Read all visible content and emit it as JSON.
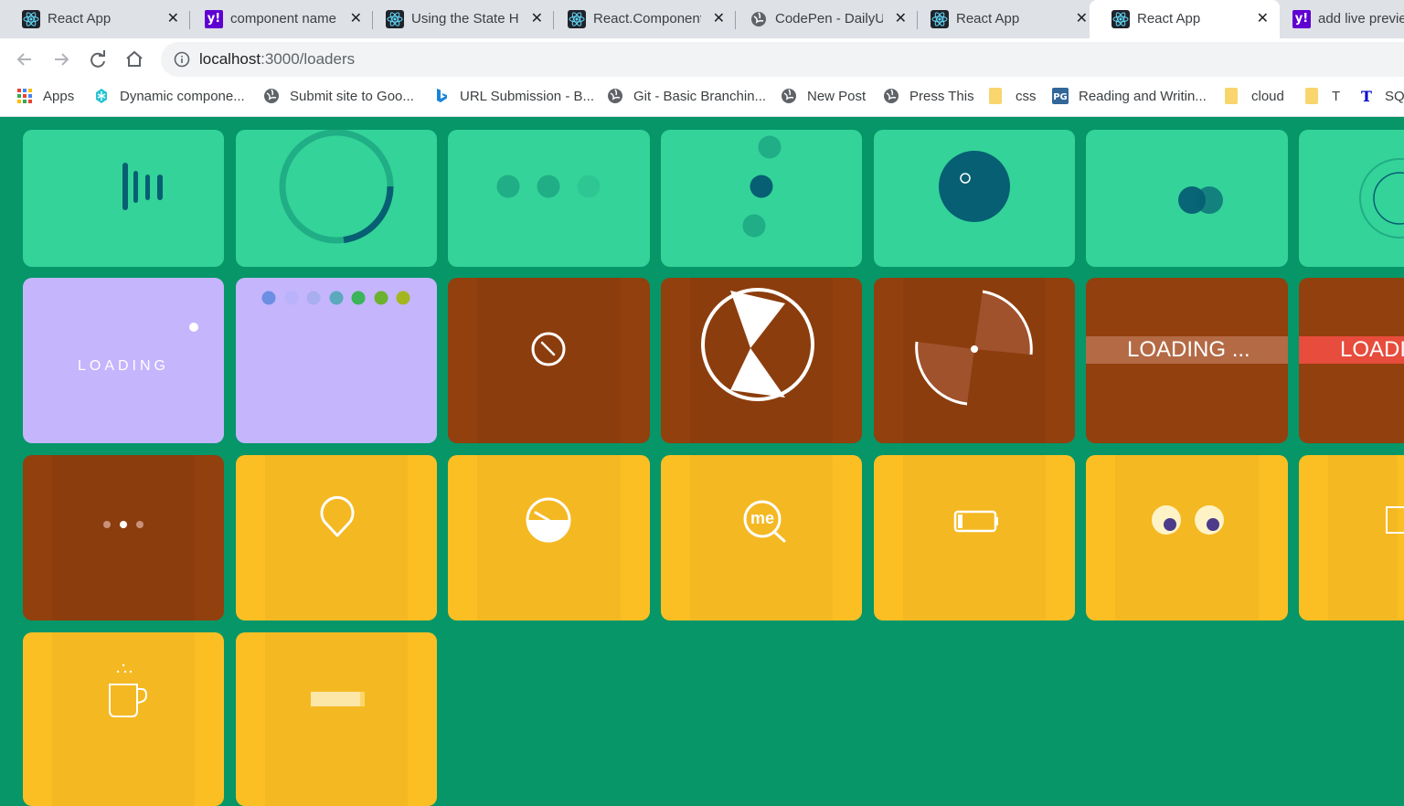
{
  "tabs": [
    {
      "label": "React App",
      "icon": "react-icon",
      "close": "✕"
    },
    {
      "label": "component name",
      "icon": "yahoo-icon",
      "close": "✕"
    },
    {
      "label": "Using the State H",
      "icon": "react-icon",
      "close": "✕"
    },
    {
      "label": "React.Component",
      "icon": "react-icon",
      "close": "✕"
    },
    {
      "label": "CodePen - DailyU",
      "icon": "globe-icon",
      "close": "✕"
    },
    {
      "label": "React App",
      "icon": "react-icon",
      "close": "✕"
    },
    {
      "label": "React App",
      "icon": "react-icon",
      "close": "✕",
      "active": true
    },
    {
      "label": "add live previe",
      "icon": "yahoo-icon"
    }
  ],
  "toolbar": {
    "url_host": "localhost",
    "url_path": ":3000/loaders"
  },
  "bookmarks": [
    {
      "label": "Apps",
      "icon": "apps-grid-icon"
    },
    {
      "label": "Dynamic compone...",
      "icon": "snowflake-icon"
    },
    {
      "label": "Submit site to Goo...",
      "icon": "globe-icon"
    },
    {
      "label": "URL Submission - B...",
      "icon": "bing-icon"
    },
    {
      "label": "Git - Basic Branchin...",
      "icon": "globe-icon"
    },
    {
      "label": "New Post",
      "icon": "globe-icon"
    },
    {
      "label": "Press This",
      "icon": "globe-icon"
    },
    {
      "label": "css",
      "icon": "folder-icon"
    },
    {
      "label": "Reading and Writin...",
      "icon": "pg-icon"
    },
    {
      "label": "cloud",
      "icon": "folder-icon"
    },
    {
      "label": "T",
      "icon": "folder-icon"
    },
    {
      "label": "SQ",
      "icon": "t-icon"
    }
  ],
  "loaders": {
    "loading_label": "LOADING",
    "bar_label_1": "LOADING ...",
    "bar_label_2": "LOADI",
    "magnifier_label": "me"
  },
  "colors": {
    "page_bg": "#069668",
    "green_card": "#34d399",
    "purple_card": "#c4b5fd",
    "brown_card": "#92400e",
    "yellow_card": "#fbbf24",
    "accent_teal": "#065f73",
    "accent_red": "#e74c3c"
  }
}
